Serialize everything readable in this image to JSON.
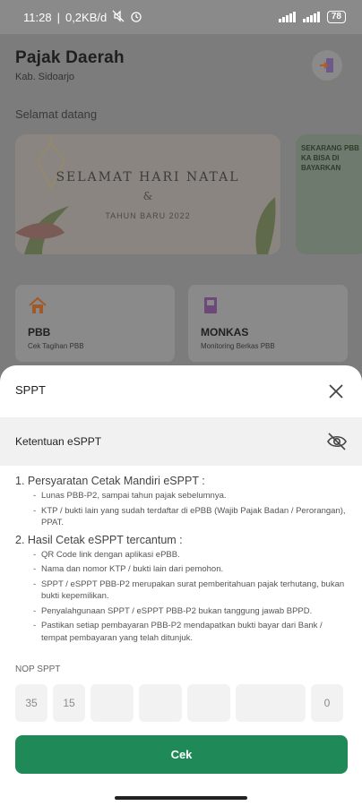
{
  "status_bar": {
    "time": "11:28",
    "network": "0,2KB/d",
    "battery": "78"
  },
  "app": {
    "title": "Pajak Daerah",
    "region": "Kab. Sidoarjo",
    "welcome": "Selamat datang",
    "banners": [
      {
        "title": "SELAMAT HARI NATAL",
        "amp": "&",
        "subtitle": "TAHUN BARU 2022"
      },
      {
        "text": "SEKARANG PBB KA BISA DI BAYARKAN"
      }
    ],
    "menu": [
      {
        "name": "PBB",
        "description": "Cek Tagihan PBB"
      },
      {
        "name": "MONKAS",
        "description": "Monitoring Berkas PBB"
      }
    ]
  },
  "sheet": {
    "title": "SPPT",
    "section_label": "Ketentuan eSPPT",
    "terms": [
      {
        "title": "1. Persyaratan Cetak Mandiri eSPPT :",
        "items": [
          "Lunas PBB-P2, sampai tahun pajak sebelumnya.",
          "KTP / bukti lain yang sudah terdaftar di ePBB (Wajib Pajak Badan / Perorangan), PPAT."
        ]
      },
      {
        "title": "2. Hasil Cetak eSPPT tercantum :",
        "items": [
          "QR Code link dengan aplikasi ePBB.",
          "Nama dan nomor KTP / bukti lain dari pemohon.",
          "SPPT / eSPPT PBB-P2 merupakan surat pemberitahuan pajak terhutang, bukan bukti kepemilikan.",
          "Penyalahgunaan SPPT / eSPPT PBB-P2 bukan tanggung jawab BPPD.",
          "Pastikan setiap pembayaran PBB-P2 mendapatkan bukti bayar dari Bank / tempat pembayaran yang telah ditunjuk."
        ]
      }
    ],
    "nop_label": "NOP SPPT",
    "nop_fields": [
      "35",
      "15",
      "",
      "",
      "",
      "",
      "0"
    ],
    "submit_label": "Cek"
  }
}
